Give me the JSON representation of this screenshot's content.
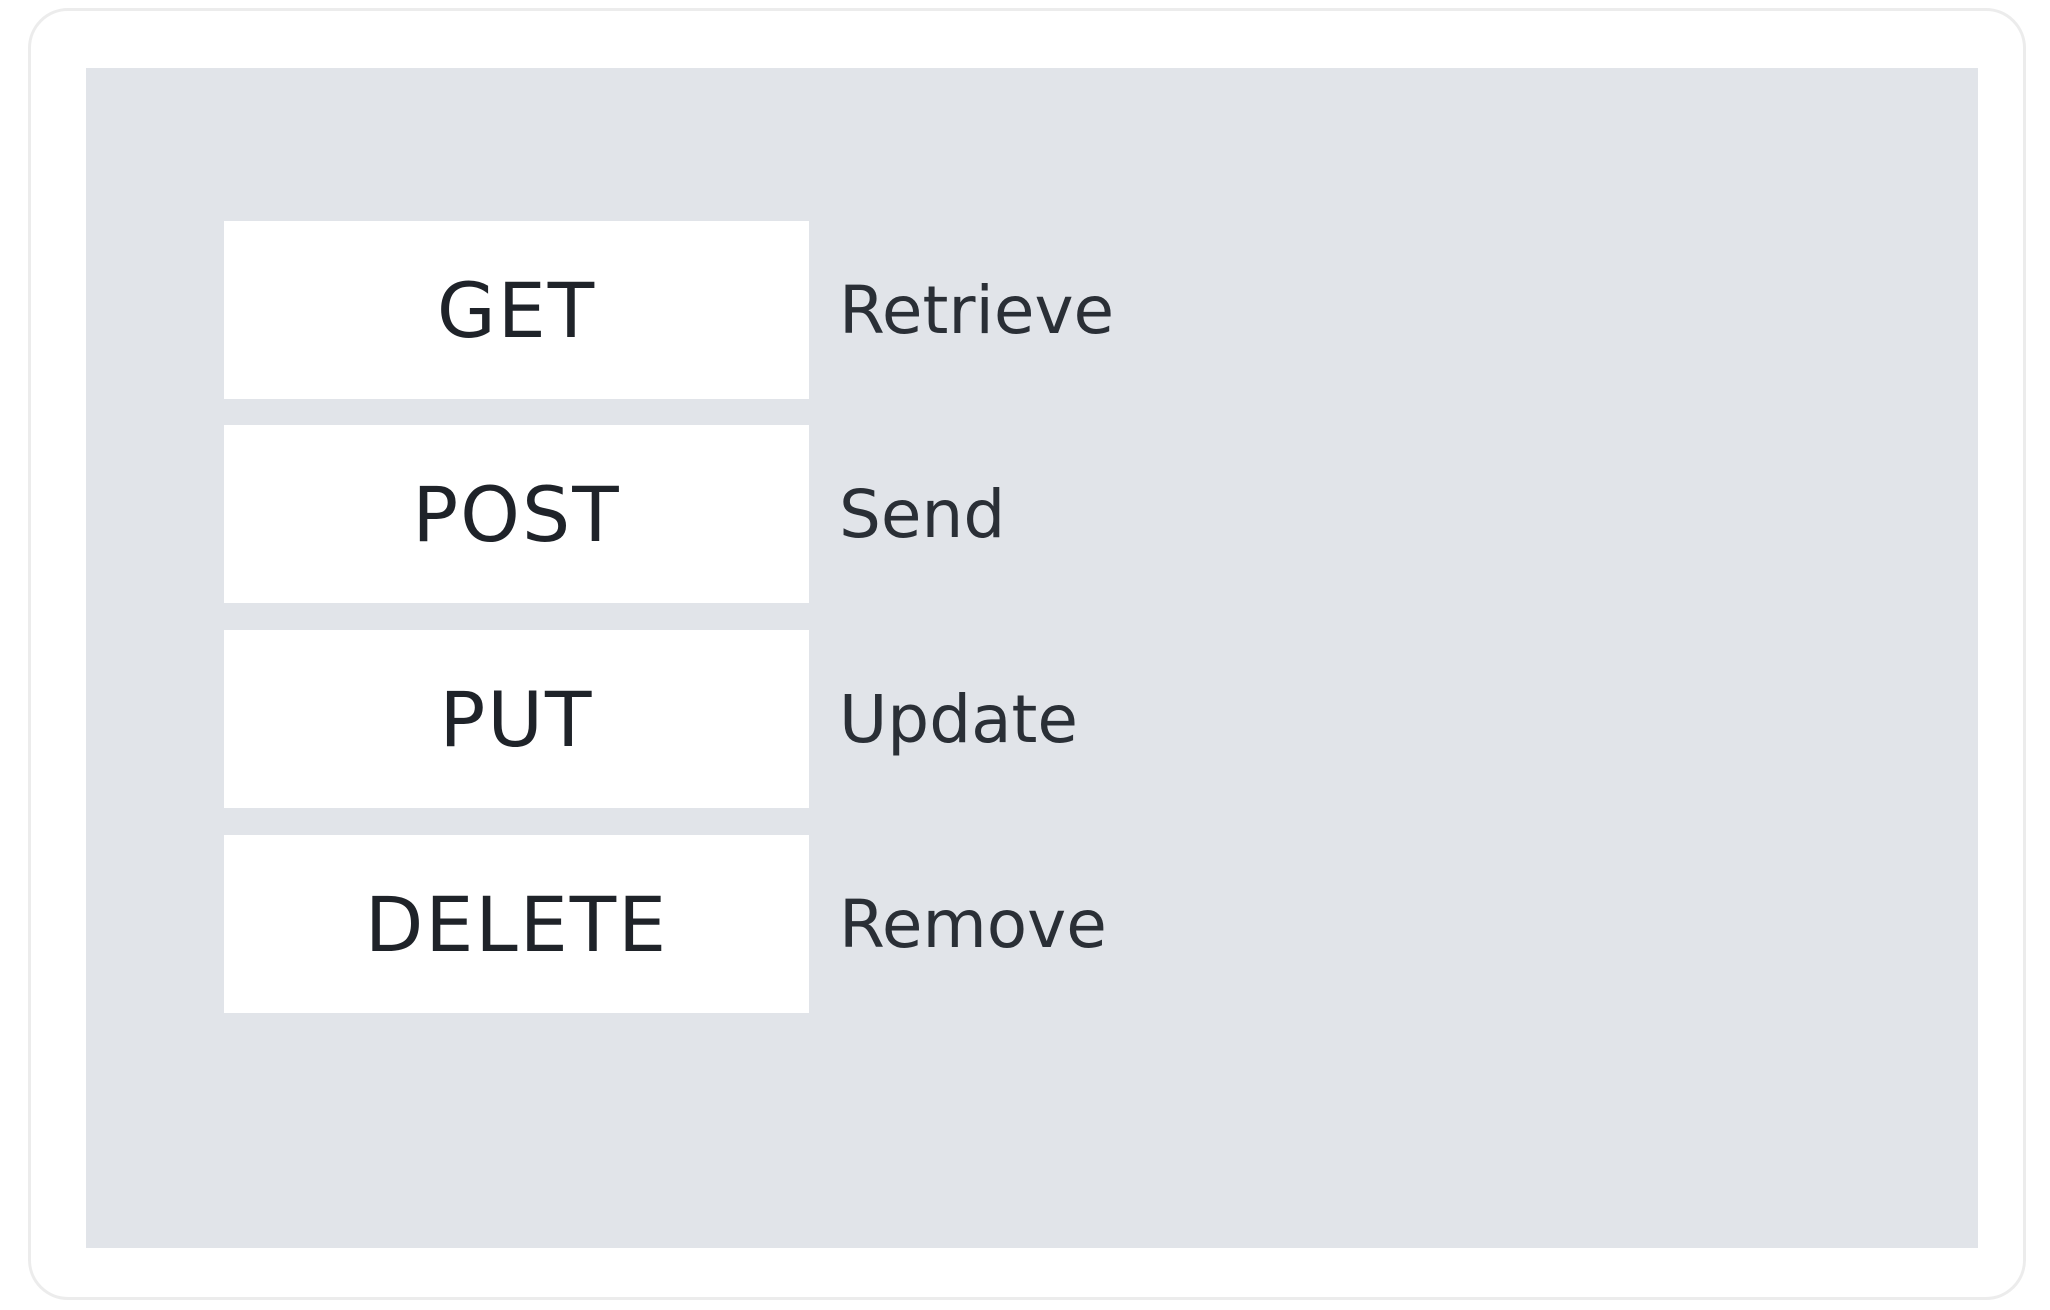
{
  "methods": [
    {
      "name": "GET",
      "description": "Retrieve"
    },
    {
      "name": "POST",
      "description": "Send"
    },
    {
      "name": "PUT",
      "description": "Update"
    },
    {
      "name": "DELETE",
      "description": "Remove"
    }
  ],
  "colors": {
    "panel_background": "#e1e4e9",
    "box_background": "#ffffff",
    "text": "#1f2329"
  }
}
